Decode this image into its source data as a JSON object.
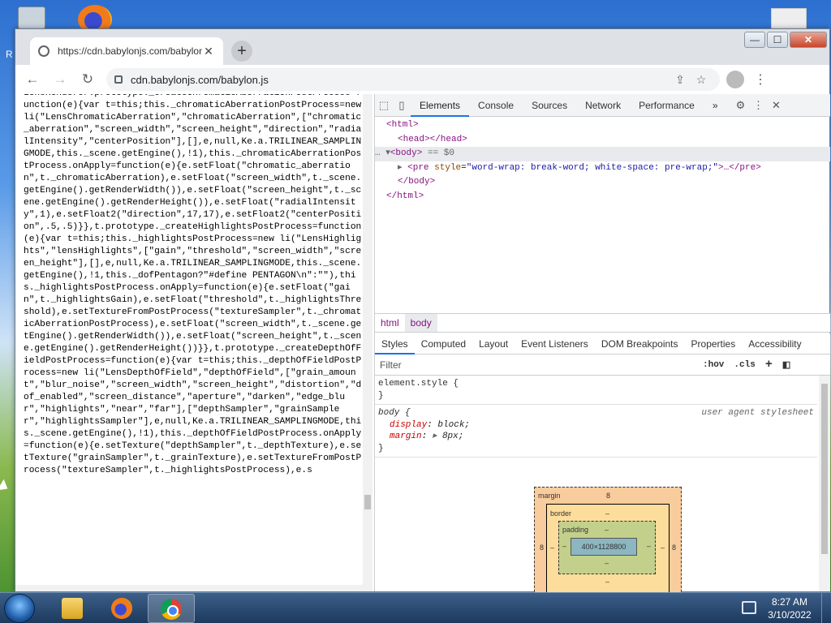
{
  "browser": {
    "tab_title": "https://cdn.babylonjs.com/babylon.js",
    "url": "cdn.babylonjs.com/babylon.js",
    "new_tab_label": "+",
    "window_min": "—",
    "window_max": "☐",
    "window_close": "✕"
  },
  "page": {
    "source_text": "LensRenderer.prototype._createChromaticAberrationPostProcess=function(e){var t=this;this._chromaticAberrationPostProcess=new li(\"LensChromaticAberration\",\"chromaticAberration\",[\"chromatic_aberration\",\"screen_width\",\"screen_height\",\"direction\",\"radialIntensity\",\"centerPosition\"],[],e,null,Ke.a.TRILINEAR_SAMPLINGMODE,this._scene.getEngine(),!1),this._chromaticAberrationPostProcess.onApply=function(e){e.setFloat(\"chromatic_aberration\",t._chromaticAberration),e.setFloat(\"screen_width\",t._scene.getEngine().getRenderWidth()),e.setFloat(\"screen_height\",t._scene.getEngine().getRenderHeight()),e.setFloat(\"radialIntensity\",1),e.setFloat2(\"direction\",17,17),e.setFloat2(\"centerPosition\",.5,.5)}},t.prototype._createHighlightsPostProcess=function(e){var t=this;this._highlightsPostProcess=new li(\"LensHighlights\",\"lensHighlights\",[\"gain\",\"threshold\",\"screen_width\",\"screen_height\"],[],e,null,Ke.a.TRILINEAR_SAMPLINGMODE,this._scene.getEngine(),!1,this._dofPentagon?\"#define PENTAGON\\n\":\"\"),this._highlightsPostProcess.onApply=function(e){e.setFloat(\"gain\",t._highlightsGain),e.setFloat(\"threshold\",t._highlightsThreshold),e.setTextureFromPostProcess(\"textureSampler\",t._chromaticAberrationPostProcess),e.setFloat(\"screen_width\",t._scene.getEngine().getRenderWidth()),e.setFloat(\"screen_height\",t._scene.getEngine().getRenderHeight())}},t.prototype._createDepthOfFieldPostProcess=function(e){var t=this;this._depthOfFieldPostProcess=new li(\"LensDepthOfField\",\"depthOfField\",[\"grain_amount\",\"blur_noise\",\"screen_width\",\"screen_height\",\"distortion\",\"dof_enabled\",\"screen_distance\",\"aperture\",\"darken\",\"edge_blur\",\"highlights\",\"near\",\"far\"],[\"depthSampler\",\"grainSampler\",\"highlightsSampler\"],e,null,Ke.a.TRILINEAR_SAMPLINGMODE,this._scene.getEngine(),!1),this._depthOfFieldPostProcess.onApply=function(e){e.setTexture(\"depthSampler\",t._depthTexture),e.setTexture(\"grainSampler\",t._grainTexture),e.setTextureFromPostProcess(\"textureSampler\",t._highlightsPostProcess),e.s"
  },
  "devtools": {
    "tabs": [
      "Elements",
      "Console",
      "Sources",
      "Network",
      "Performance",
      "»"
    ],
    "dom": {
      "html_open": "<html>",
      "head": "<head></head>",
      "body_open": "<body>",
      "body_marker": "== $0",
      "pre_open": "<pre",
      "pre_attr_name": "style",
      "pre_attr_value": "\"word-wrap: break-word; white-space: pre-wrap;\"",
      "pre_close": ">…</pre>",
      "body_close": "</body>",
      "html_close": "</html>",
      "selection_dots": "…"
    },
    "breadcrumbs": [
      "html",
      "body"
    ],
    "subtabs": [
      "Styles",
      "Computed",
      "Layout",
      "Event Listeners",
      "DOM Breakpoints",
      "Properties",
      "Accessibility"
    ],
    "filter_placeholder": "Filter",
    "hov": ":hov",
    "cls": ".cls",
    "plus": "+",
    "styles": {
      "element_selector": "element.style {",
      "close_brace": "}",
      "body_selector": "body {",
      "body_source": "user agent stylesheet",
      "display_prop": "display",
      "display_val": "block;",
      "margin_prop": "margin",
      "margin_val": "8px;"
    },
    "boxmodel": {
      "margin_label": "margin",
      "margin_value": "8",
      "border_label": "border",
      "border_value": "–",
      "padding_label": "padding",
      "padding_value": "–",
      "content_size": "400×1128800",
      "side_left_margin": "8",
      "side_right_margin": "8",
      "dash": "–"
    }
  },
  "taskbar": {
    "time": "8:27 AM",
    "date": "3/10/2022"
  },
  "desktop": {
    "left_edge_letter": "R"
  }
}
